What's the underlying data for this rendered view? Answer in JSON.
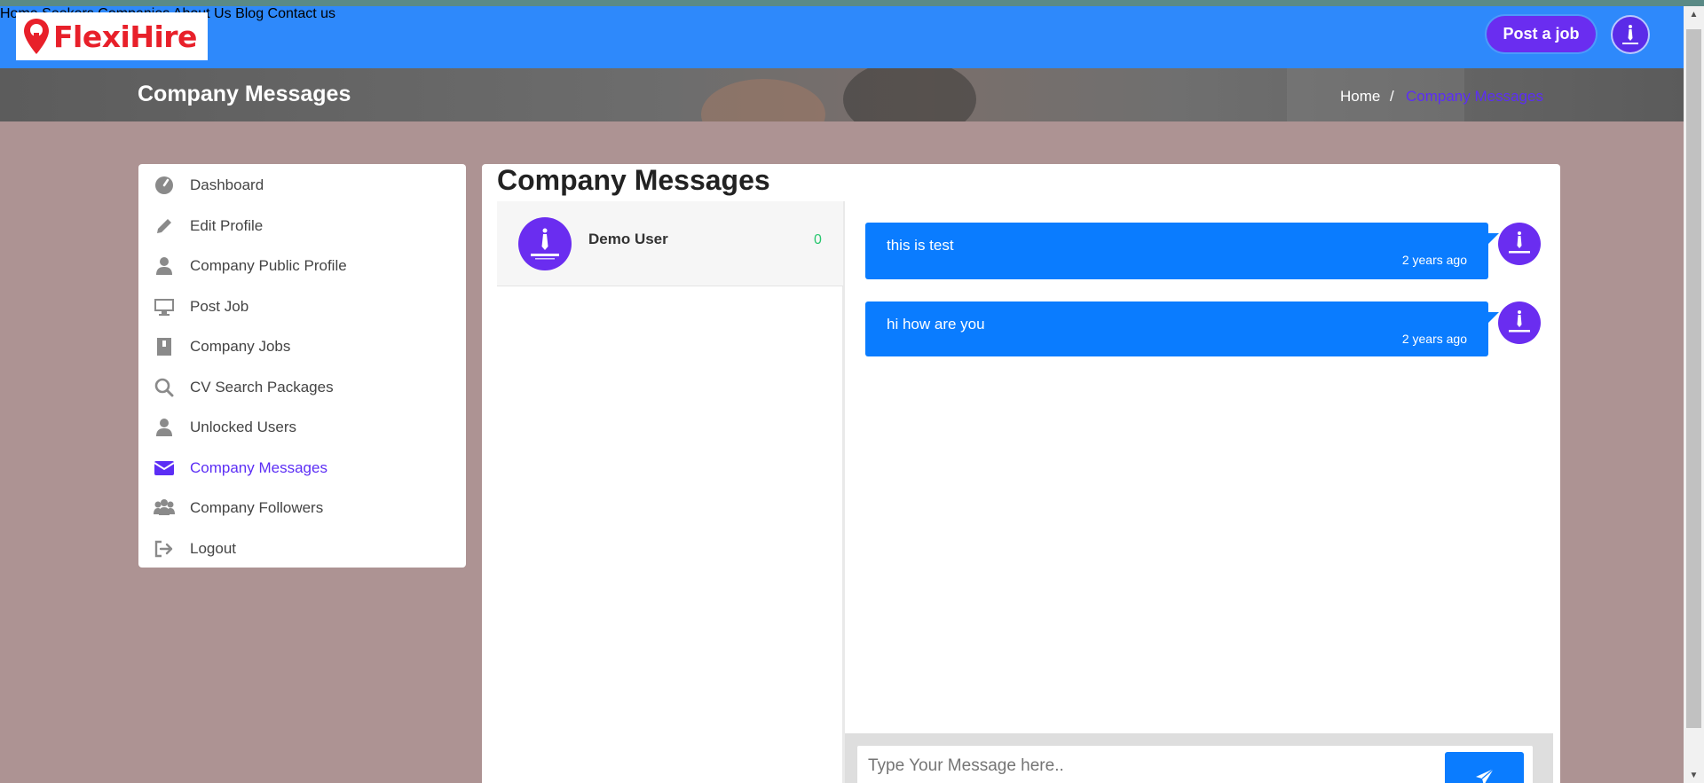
{
  "header": {
    "logo_text": "FlexiHire",
    "nav": [
      {
        "label": "Home"
      },
      {
        "label": "Seekers"
      },
      {
        "label": "Companies"
      },
      {
        "label": "About Us"
      },
      {
        "label": "Blog"
      },
      {
        "label": "Contact us"
      }
    ],
    "post_job_label": "Post a job"
  },
  "banner": {
    "title": "Company Messages",
    "breadcrumb_home": "Home",
    "breadcrumb_sep": "/",
    "breadcrumb_current": "Company Messages"
  },
  "sidebar": {
    "items": [
      {
        "label": "Dashboard",
        "icon": "dashboard-icon"
      },
      {
        "label": "Edit Profile",
        "icon": "pencil-icon"
      },
      {
        "label": "Company Public Profile",
        "icon": "user-icon"
      },
      {
        "label": "Post Job",
        "icon": "desktop-icon"
      },
      {
        "label": "Company Jobs",
        "icon": "briefcase-icon"
      },
      {
        "label": "CV Search Packages",
        "icon": "search-icon"
      },
      {
        "label": "Unlocked Users",
        "icon": "user-icon"
      },
      {
        "label": "Company Messages",
        "icon": "envelope-icon",
        "active": true
      },
      {
        "label": "Company Followers",
        "icon": "users-icon"
      },
      {
        "label": "Logout",
        "icon": "logout-icon"
      }
    ]
  },
  "main": {
    "title": "Company Messages",
    "contacts": [
      {
        "name": "Demo User",
        "unread": "0"
      }
    ],
    "messages": [
      {
        "text": "this is test",
        "time": "2 years ago"
      },
      {
        "text": "hi how are you",
        "time": "2 years ago"
      }
    ],
    "composer": {
      "placeholder": "Type Your Message here.."
    }
  },
  "colors": {
    "header_bg": "#2e89fb",
    "accent_purple": "#6a2df0",
    "bubble_blue": "#0a7cff",
    "page_bg": "#ad9393"
  }
}
